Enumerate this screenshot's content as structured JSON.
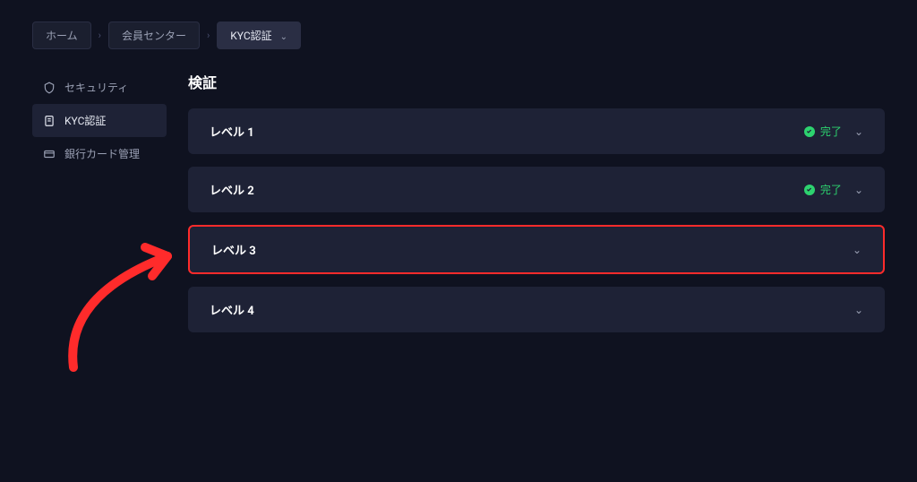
{
  "breadcrumb": {
    "items": [
      {
        "label": "ホーム",
        "active": false
      },
      {
        "label": "会員センター",
        "active": false
      },
      {
        "label": "KYC認証",
        "active": true,
        "hasDropdown": true
      }
    ]
  },
  "sidebar": {
    "items": [
      {
        "label": "セキュリティ",
        "icon": "shield",
        "active": false
      },
      {
        "label": "KYC認証",
        "icon": "document",
        "active": true
      },
      {
        "label": "銀行カード管理",
        "icon": "card",
        "active": false
      }
    ]
  },
  "page": {
    "title": "検証"
  },
  "levels": [
    {
      "label": "レベル 1",
      "status": "完了",
      "completed": true,
      "highlighted": false
    },
    {
      "label": "レベル 2",
      "status": "完了",
      "completed": true,
      "highlighted": false
    },
    {
      "label": "レベル 3",
      "status": "",
      "completed": false,
      "highlighted": true
    },
    {
      "label": "レベル 4",
      "status": "",
      "completed": false,
      "highlighted": false
    }
  ],
  "annotation": {
    "arrowColor": "#ff2b2b"
  }
}
